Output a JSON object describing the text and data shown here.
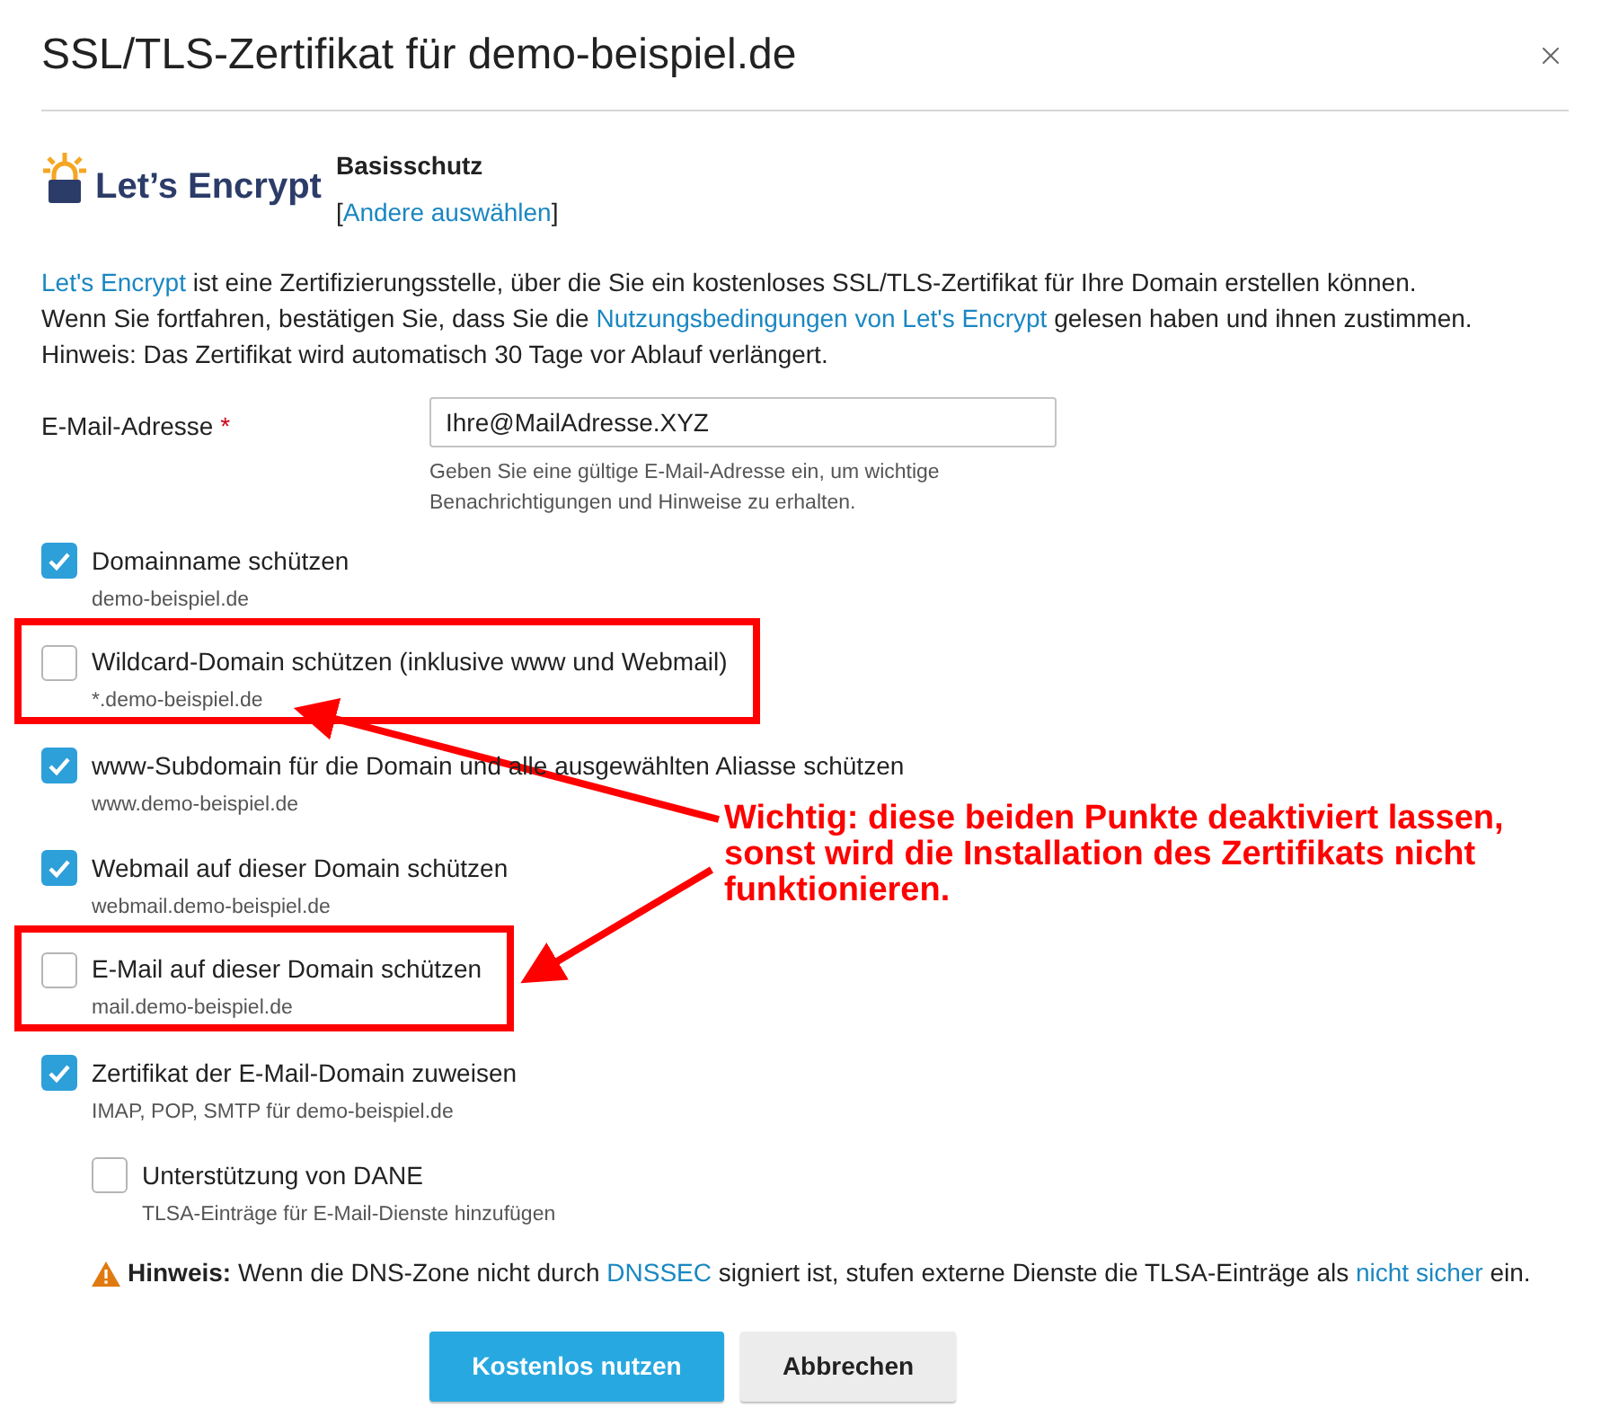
{
  "dialog": {
    "title": "SSL/TLS-Zertifikat für demo-beispiel.de"
  },
  "provider": {
    "logo_text": "Let’s Encrypt",
    "plan": "Basisschutz",
    "bracket_open": "[",
    "change_link": "Andere auswählen",
    "bracket_close": "]"
  },
  "intro": [
    [
      {
        "kind": "link",
        "text": "Let's Encrypt"
      },
      {
        "kind": "text",
        "text": " ist eine Zertifizierungsstelle, über die Sie ein kostenloses SSL/TLS-Zertifikat für Ihre Domain erstellen können."
      }
    ],
    [
      {
        "kind": "text",
        "text": "Wenn Sie fortfahren, bestätigen Sie, dass Sie die "
      },
      {
        "kind": "link",
        "text": "Nutzungsbedingungen von Let's Encrypt"
      },
      {
        "kind": "text",
        "text": " gelesen haben und ihnen zustimmen."
      }
    ],
    [
      {
        "kind": "text",
        "text": "Hinweis: Das Zertifikat wird automatisch 30 Tage vor Ablauf verlängert."
      }
    ]
  ],
  "email": {
    "label": "E-Mail-Adresse",
    "required_mark": "*",
    "value": "Ihre@MailAdresse.XYZ",
    "hint": "Geben Sie eine gültige E-Mail-Adresse ein, um wichtige Benachrichtigungen und Hinweise zu erhalten."
  },
  "options": [
    {
      "label": "Domainname schützen",
      "sublabel": "demo-beispiel.de",
      "checked": true,
      "highlighted": false
    },
    {
      "label": "Wildcard-Domain schützen (inklusive www und Webmail)",
      "sublabel": "*.demo-beispiel.de",
      "checked": false,
      "highlighted": true
    },
    {
      "label": "www-Subdomain für die Domain und alle ausgewählten Aliasse schützen",
      "sublabel": "www.demo-beispiel.de",
      "checked": true,
      "highlighted": false
    },
    {
      "label": "Webmail auf dieser Domain schützen",
      "sublabel": "webmail.demo-beispiel.de",
      "checked": true,
      "highlighted": false
    },
    {
      "label": "E-Mail auf dieser Domain schützen",
      "sublabel": "mail.demo-beispiel.de",
      "checked": false,
      "highlighted": true
    },
    {
      "label": "Zertifikat der E-Mail-Domain zuweisen",
      "sublabel": "IMAP, POP, SMTP für demo-beispiel.de",
      "checked": true,
      "highlighted": false,
      "children": [
        {
          "label": "Unterstützung von DANE",
          "sublabel": "TLSA-Einträge für E-Mail-Dienste hinzufügen",
          "checked": false,
          "highlighted": false
        }
      ]
    }
  ],
  "notice": [
    {
      "kind": "bold",
      "text": "Hinweis:"
    },
    {
      "kind": "text",
      "text": " Wenn die DNS-Zone nicht durch "
    },
    {
      "kind": "link",
      "text": "DNSSEC"
    },
    {
      "kind": "text",
      "text": " signiert ist, stufen externe Dienste die TLSA-Einträge als "
    },
    {
      "kind": "link",
      "text": "nicht sicher"
    },
    {
      "kind": "text",
      "text": " ein."
    }
  ],
  "buttons": [
    {
      "label": "Kostenlos nutzen",
      "kind": "primary"
    },
    {
      "label": "Abbrechen",
      "kind": "secondary"
    }
  ],
  "annotation": {
    "text": "Wichtig: diese beiden Punkte deaktiviert lassen, sonst wird die Installation des Zertifikats nicht funktionieren."
  }
}
